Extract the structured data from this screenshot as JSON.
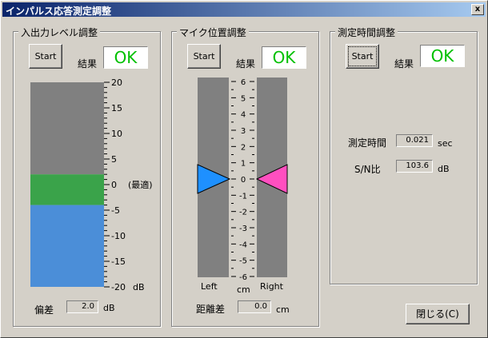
{
  "window": {
    "title": "インパルス応答測定調整",
    "close_glyph": "x"
  },
  "io_panel": {
    "label": "入出力レベル調整",
    "start_label": "Start",
    "result_label": "結果",
    "result_value": "OK",
    "scale": [
      "20",
      "15",
      "10",
      "5",
      "0",
      "-5",
      "-10",
      "-15",
      "-20"
    ],
    "scale_unit": "dB",
    "optimal_note": "(最適)",
    "deviation_label": "偏差",
    "deviation_value": "2.0",
    "deviation_unit": "dB",
    "meter_bands": [
      {
        "from": 20,
        "to": 2,
        "color": "#808080"
      },
      {
        "from": 2,
        "to": -4,
        "color": "#3aa34a"
      },
      {
        "from": -4,
        "to": -20,
        "color": "#4b8ed8"
      }
    ]
  },
  "mic_panel": {
    "label": "マイク位置調整",
    "start_label": "Start",
    "result_label": "結果",
    "result_value": "OK",
    "scale": [
      "6",
      "5",
      "4",
      "3",
      "2",
      "1",
      "0",
      "-1",
      "-2",
      "-3",
      "-4",
      "-5",
      "-6"
    ],
    "left_label": "Left",
    "right_label": "Right",
    "unit": "cm",
    "left_marker_value": 0,
    "right_marker_value": 0,
    "left_marker_color": "#1e90ff",
    "right_marker_color": "#ff4fc0",
    "distance_label": "距離差",
    "distance_value": "0.0",
    "distance_unit": "cm"
  },
  "timing_panel": {
    "label": "測定時間調整",
    "start_label": "Start",
    "result_label": "結果",
    "result_value": "OK",
    "time_label": "測定時間",
    "time_value": "0.021",
    "time_unit": "sec",
    "sn_label": "S/N比",
    "sn_value": "103.6",
    "sn_unit": "dB"
  },
  "close_button_label": "閉じる(C)"
}
